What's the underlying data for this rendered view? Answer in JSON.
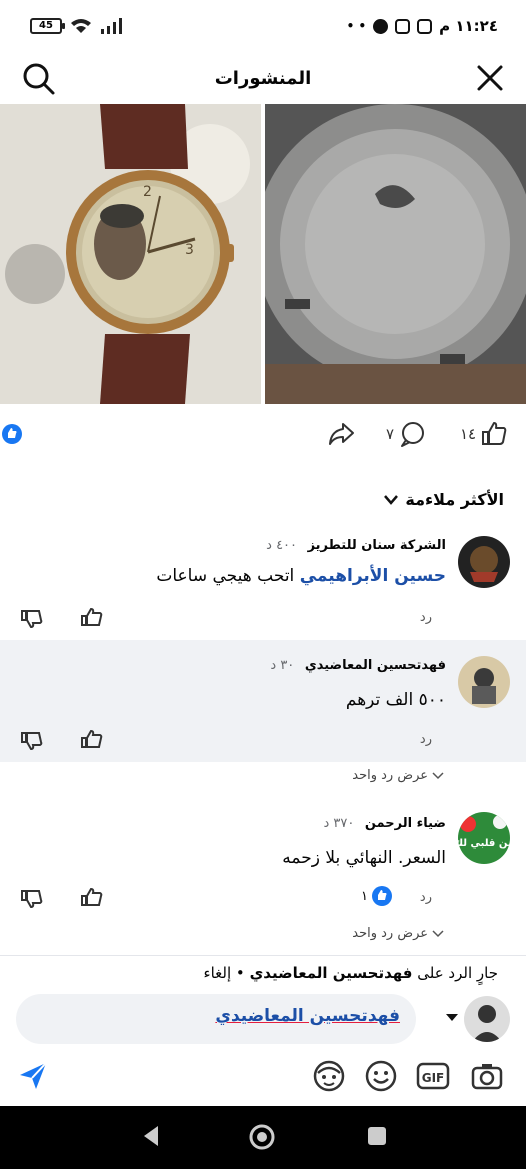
{
  "status": {
    "time": "١١:٢٤ م",
    "battery": "45"
  },
  "header": {
    "title": "المنشورات"
  },
  "post": {
    "like_count": "١٤",
    "comment_count": "٧"
  },
  "sort": {
    "label": "الأكثر ملاءمة"
  },
  "comments": [
    {
      "author": "الشركة سنان للتطريز",
      "time": "٤٠٠ د",
      "mention": "حسين الأبراهيمي",
      "text": "اتحب هيجي ساعات",
      "reply_label": "رد"
    },
    {
      "author": "فهدتحسين المعاضيدي",
      "time": "٣٠ د",
      "text": "٥٠٠ الف ترهم",
      "reply_label": "رد",
      "view_replies": "عرض رد واحد"
    },
    {
      "author": "ضياء الرحمن",
      "time": "٣٧٠ د",
      "text": "السعر. النهائي بلا زحمه",
      "reply_label": "رد",
      "reaction_count": "١",
      "view_replies": "عرض رد واحد",
      "avatar_text": "من قلبي لك"
    }
  ],
  "composer": {
    "replying_prefix": "جارٍ الرد على",
    "replying_to": "فهدتحسين المعاضيدي",
    "separator": "•",
    "cancel": "إلغاء",
    "input_value": "فهدتحسين المعاضيدي"
  },
  "colors": {
    "accent": "#1877f2",
    "mention": "#1c4fa7",
    "highlight": "#f0f2f5"
  }
}
